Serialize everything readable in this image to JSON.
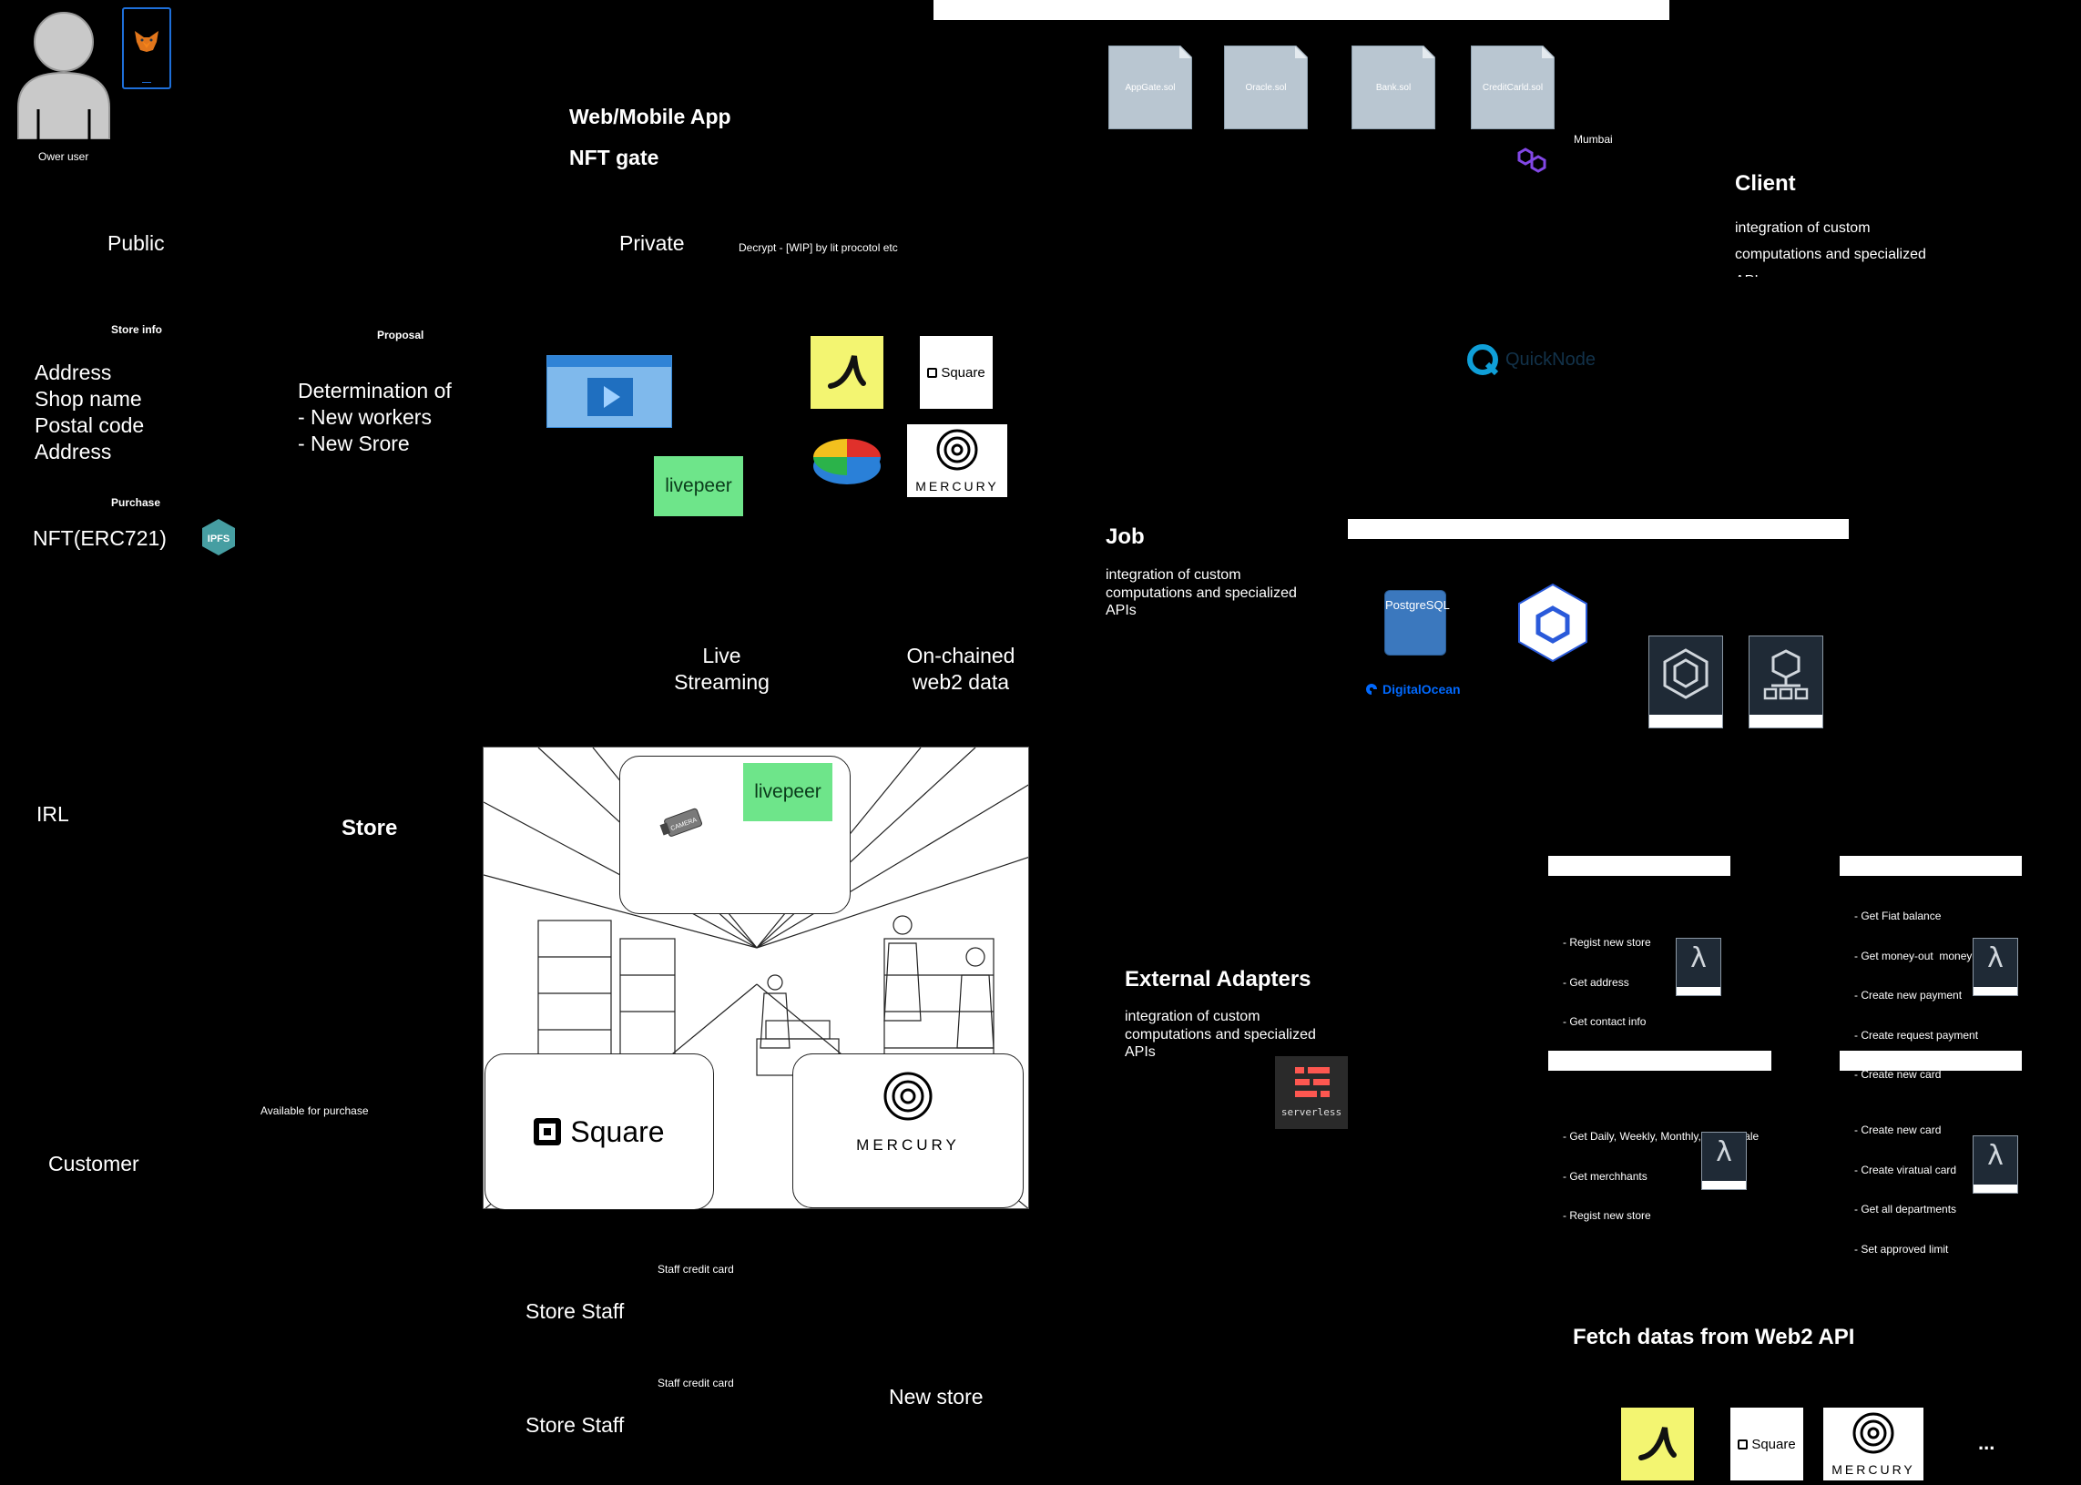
{
  "user": {
    "label": "Ower user"
  },
  "app": {
    "title": "Web/Mobile App",
    "subtitle": "NFT gate"
  },
  "sections": {
    "public": "Public",
    "private": "Private",
    "decrypt_note": "Decrypt - [WIP] by lit procotol etc",
    "irl": "IRL",
    "store": "Store",
    "available": "Available for purchase",
    "customer": "Customer"
  },
  "store_info": {
    "heading": "Store info",
    "lines": [
      "Address",
      "Shop name",
      "Postal code",
      "Address"
    ]
  },
  "proposal": {
    "heading": "Proposal",
    "lines": [
      "Determination of",
      "- New workers",
      "- New Srore"
    ]
  },
  "purchase": {
    "heading": "Purchase",
    "nft": "NFT(ERC721)",
    "ipfs": "IPFS"
  },
  "contracts": [
    "AppGate.sol",
    "Oracle.sol",
    "Bank.sol",
    "CreditCarld.sol"
  ],
  "network": {
    "label": "Mumbai"
  },
  "client": {
    "title": "Client",
    "desc_lines": [
      "integration of custom",
      "computations and specialized",
      "APIs"
    ]
  },
  "quicknode": {
    "label": "QuickNode"
  },
  "brands": {
    "square": "Square",
    "livepeer": "livepeer",
    "mercury": "MERCURY",
    "postgres": "PostgreSQL",
    "digitalocean": "DigitalOcean",
    "serverless": "serverless",
    "camera": "CAMERA"
  },
  "captions": {
    "live_streaming": [
      "Live",
      "Streaming"
    ],
    "onchained": [
      "On-chained",
      "web2 data"
    ]
  },
  "job": {
    "title": "Job",
    "desc_lines": [
      "integration of custom",
      "computations and specialized",
      "APIs"
    ]
  },
  "external": {
    "title": "External Adapters",
    "desc_lines": [
      "integration of custom",
      "computations and specialized",
      "APIs"
    ]
  },
  "lambdas": [
    {
      "items": [
        "- Regist new store",
        "- Get address",
        "- Get contact info"
      ]
    },
    {
      "items": [
        "- Get Fiat balance",
        "- Get money-out  money-in tx",
        "- Create new payment",
        "- Create request payment",
        "- Create new card"
      ]
    },
    {
      "items": [
        "- Get Daily, Weekly, Monthly, Yearly Sale",
        "- Get merchhants",
        "- Regist new store"
      ]
    },
    {
      "items": [
        "- Create new card",
        "- Create viratual card",
        "- Get all departments",
        "- Set approved limit"
      ]
    }
  ],
  "staff": [
    {
      "card": "Staff credit card",
      "label": "Store Staff"
    },
    {
      "card": "Staff credit card",
      "label": "Store Staff"
    }
  ],
  "new_store": "New store",
  "fetch": {
    "title": "Fetch datas from Web2 API",
    "ellipsis": "..."
  },
  "colors": {
    "background": "#000000",
    "livepeer_green": "#6ee58a",
    "yellow_brand": "#f3f571",
    "polygon_purple": "#8247e5",
    "quicknode_cyan": "#0f9fd8",
    "postgres_blue": "#336791",
    "digitalocean_blue": "#0069ff",
    "serverless_red": "#fd5750"
  }
}
